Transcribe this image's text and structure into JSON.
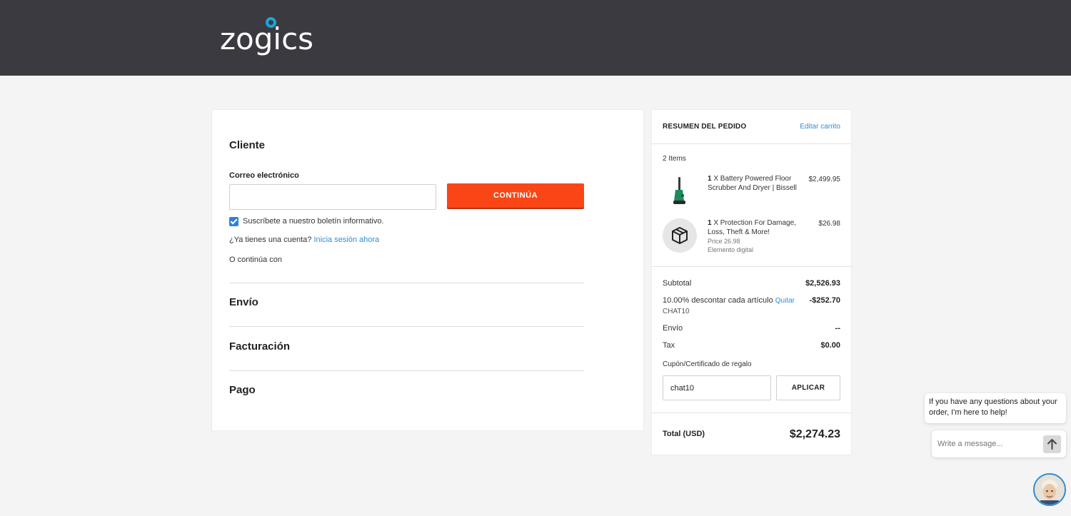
{
  "header": {
    "logo": "zogics"
  },
  "checkout": {
    "customer_title": "Cliente",
    "email_label": "Correo electrónico",
    "email_value": "",
    "continue_label": "CONTINÚA",
    "newsletter_label": "Suscríbete a nuestro boletín informativo.",
    "newsletter_checked": true,
    "account_question": "¿Ya tienes una cuenta?",
    "signin_link": "Inicia sesión ahora",
    "or_continue": "O continúa con",
    "shipping_title": "Envío",
    "billing_title": "Facturación",
    "payment_title": "Pago"
  },
  "summary": {
    "title": "RESUMEN DEL PEDIDO",
    "edit_cart": "Editar carrito",
    "items_count": "2 Items",
    "items": [
      {
        "qty": "1",
        "name": "X Battery Powered Floor Scrubber And Dryer | Bissell",
        "price": "$2,499.95",
        "icon": "floor-scrubber-image"
      },
      {
        "qty": "1",
        "name": "X Protection For Damage, Loss, Theft & More!",
        "price": "$26.98",
        "meta1": "Price 26.98",
        "meta2": "Elemento digital",
        "icon": "package-icon"
      }
    ],
    "subtotal_label": "Subtotal",
    "subtotal_value": "$2,526.93",
    "discount_label": "10.00% descontar cada artículo",
    "discount_remove": "Quitar",
    "discount_code": "CHAT10",
    "discount_value": "-$252.70",
    "shipping_label": "Envío",
    "shipping_value": "--",
    "tax_label": "Tax",
    "tax_value": "$0.00",
    "coupon_label": "Cupón/Certificado de regalo",
    "coupon_value": "chat10",
    "apply_label": "APLICAR",
    "total_label": "Total (USD)",
    "total_value": "$2,274.23"
  },
  "chat": {
    "message": "If you have any questions about your order, I'm here to help!",
    "input_placeholder": "Write a message..."
  },
  "colors": {
    "header_bg": "#3a3a40",
    "accent": "#fa4616",
    "link": "#2f8fd0",
    "logo_dot": "#19a7d8"
  }
}
